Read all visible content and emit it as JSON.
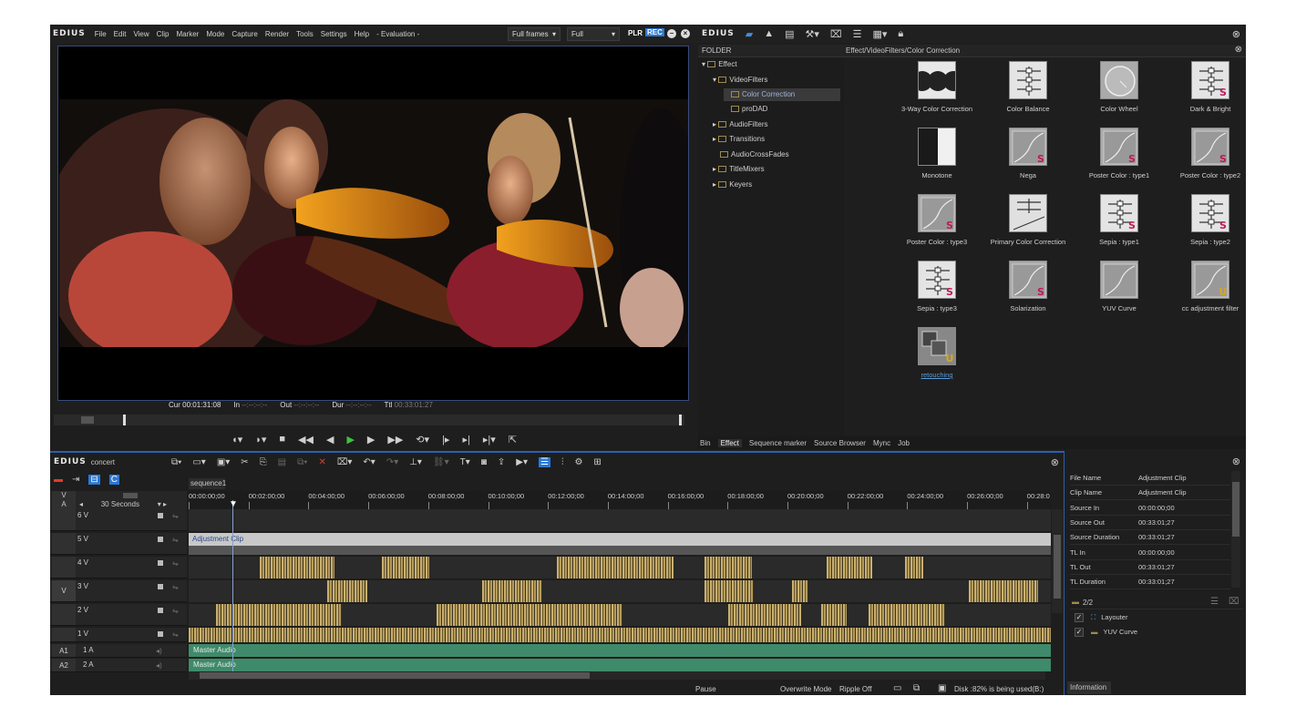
{
  "player": {
    "logo": "EDIUS",
    "menu": [
      "File",
      "Edit",
      "View",
      "Clip",
      "Marker",
      "Mode",
      "Capture",
      "Render",
      "Tools",
      "Settings",
      "Help",
      "- Evaluation -"
    ],
    "frames_select": "Full frames",
    "quality_select": "Full",
    "plr": "PLR",
    "rec": "REC",
    "timecodes": {
      "cur_label": "Cur",
      "cur": "00:01:31:08",
      "in_label": "In",
      "in": "--:--:--:--",
      "out_label": "Out",
      "out": "--:--:--:--",
      "dur_label": "Dur",
      "dur": "--:--:--:--",
      "ttl_label": "Ttl",
      "ttl": "00:33:01:27"
    }
  },
  "bin": {
    "logo": "EDIUS",
    "folder_header": "FOLDER",
    "path": "Effect/VideoFilters/Color Correction",
    "tree": [
      {
        "label": "Effect"
      },
      {
        "label": "VideoFilters"
      },
      {
        "label": "Color Correction",
        "selected": true
      },
      {
        "label": "proDAD"
      },
      {
        "label": "AudioFilters"
      },
      {
        "label": "Transitions"
      },
      {
        "label": "AudioCrossFades"
      },
      {
        "label": "TitleMixers"
      },
      {
        "label": "Keyers"
      }
    ],
    "effects": [
      {
        "label": "3-Way Color Correction",
        "badge": ""
      },
      {
        "label": "Color Balance",
        "badge": ""
      },
      {
        "label": "Color Wheel",
        "badge": ""
      },
      {
        "label": "Dark & Bright",
        "badge": "S"
      },
      {
        "label": "Monotone",
        "badge": ""
      },
      {
        "label": "Nega",
        "badge": "S"
      },
      {
        "label": "Poster Color : type1",
        "badge": "S"
      },
      {
        "label": "Poster Color : type2",
        "badge": "S"
      },
      {
        "label": "Poster Color : type3",
        "badge": "S"
      },
      {
        "label": "Primary Color Correction",
        "badge": ""
      },
      {
        "label": "Sepia : type1",
        "badge": "S"
      },
      {
        "label": "Sepia : type2",
        "badge": "S"
      },
      {
        "label": "Sepia : type3",
        "badge": "S"
      },
      {
        "label": "Solarization",
        "badge": "S"
      },
      {
        "label": "YUV Curve",
        "badge": ""
      },
      {
        "label": "cc adjustment filter",
        "badge": "U"
      },
      {
        "label": "retouching",
        "badge": "U"
      }
    ],
    "tabs": [
      "Bin",
      "Effect",
      "Sequence marker",
      "Source Browser",
      "Mync",
      "Job"
    ],
    "active_tab": "Effect"
  },
  "timeline": {
    "logo": "EDIUS",
    "project": "concert",
    "sequence_tab": "sequence1",
    "zoom": "30 Seconds",
    "ruler": [
      "00:00:00;00",
      "00:02:00;00",
      "00:04:00;00",
      "00:06:00;00",
      "00:08:00;00",
      "00:10:00;00",
      "00:12:00;00",
      "00:14:00;00",
      "00:16:00;00",
      "00:18:00;00",
      "00:20:00;00",
      "00:22:00;00",
      "00:24:00;00",
      "00:26:00;00",
      "00:28:0"
    ],
    "tracks": [
      {
        "label": "6 V"
      },
      {
        "label": "5 V",
        "clip_label": "Adjustment Clip"
      },
      {
        "label": "4 V"
      },
      {
        "label": "3 V"
      },
      {
        "label": "2 V"
      },
      {
        "label": "1 V"
      }
    ],
    "audio_tracks": [
      {
        "side": "A1",
        "label": "1 A",
        "clip_label": "Master Audio"
      },
      {
        "side": "A2",
        "label": "2 A",
        "clip_label": "Master Audio"
      }
    ],
    "side_labels": {
      "v": "V",
      "a": "A",
      "v3": "V"
    },
    "status": {
      "state": "Pause",
      "mode": "Overwrite Mode",
      "ripple": "Ripple Off",
      "disk": "Disk :82% is being used(B:)"
    }
  },
  "info": {
    "rows": [
      {
        "key": "File Name",
        "value": "Adjustment Clip"
      },
      {
        "key": "Clip Name",
        "value": "Adjustment Clip"
      },
      {
        "key": "Source In",
        "value": "00:00:00;00"
      },
      {
        "key": "Source Out",
        "value": "00:33:01;27"
      },
      {
        "key": "Source Duration",
        "value": "00:33:01;27"
      },
      {
        "key": "TL In",
        "value": "00:00:00;00"
      },
      {
        "key": "TL Out",
        "value": "00:33:01;27"
      },
      {
        "key": "TL Duration",
        "value": "00:33:01;27"
      }
    ],
    "filter_count": "2/2",
    "filters": [
      "Layouter",
      "YUV Curve"
    ],
    "tab": "Information"
  },
  "colors": {
    "accent": "#2a78d6",
    "clip_gold": "#c9b070",
    "audio_green": "#3f8a6a",
    "badge_s": "#c0195a",
    "badge_u": "#d9a520"
  }
}
